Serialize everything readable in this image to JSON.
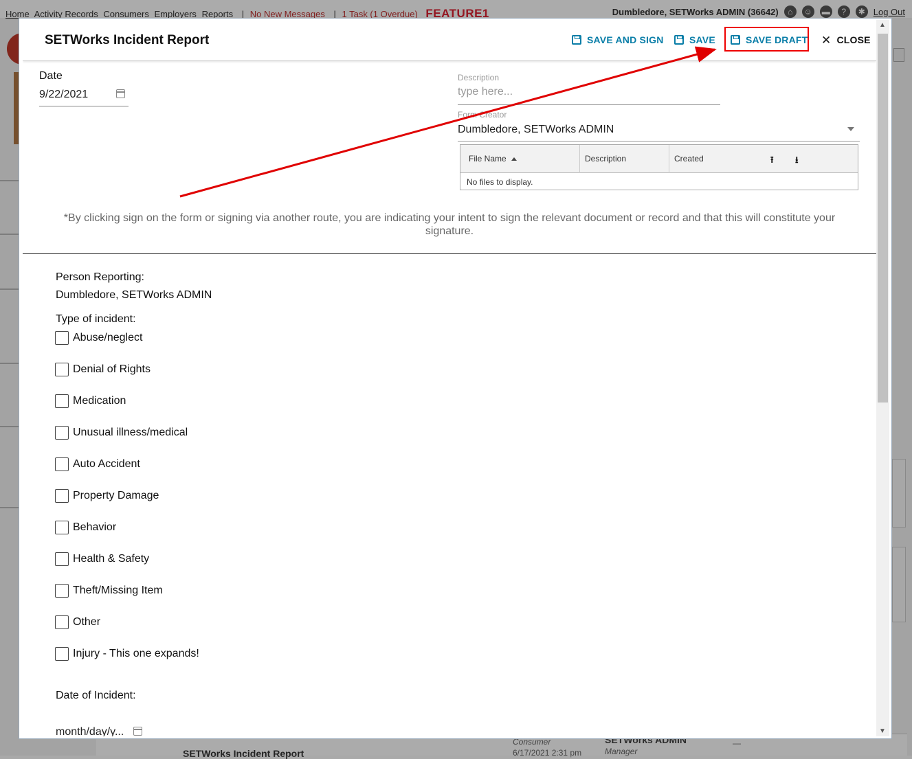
{
  "background": {
    "nav_links": [
      "Home",
      "Activity Records",
      "Consumers",
      "Employers",
      "Reports"
    ],
    "messages_link": "No New Messages",
    "tasks_link": "1 Task (1 Overdue)",
    "environment_label": "FEATURE1",
    "user_label": "Dumbledore, SETWorks ADMIN (36642)",
    "logout_label": "Log Out",
    "row_title": "SETWorks Incident Report",
    "row_consumer_label": "Consumer",
    "row_date": "6/17/2021 2:31 pm",
    "row_user": "SETWorks ADMIN",
    "row_role": "Manager",
    "row_dash": "—"
  },
  "modal": {
    "title": "SETWorks Incident Report",
    "actions": {
      "save_and_sign": "SAVE AND SIGN",
      "save": "SAVE",
      "save_draft": "SAVE DRAFT",
      "close": "CLOSE"
    },
    "date_label": "Date",
    "date_value": "9/22/2021",
    "description_label": "Description",
    "description_placeholder": "type here...",
    "form_creator_label": "Form Creator",
    "form_creator_value": "Dumbledore, SETWorks ADMIN",
    "files": {
      "columns": [
        "File Name",
        "Description",
        "Created"
      ],
      "empty_text": "No files to display."
    },
    "disclaimer": "*By clicking sign on the form or signing via another route, you are indicating your intent to sign the relevant document or record and that this will constitute your signature.",
    "person_reporting_label": "Person Reporting:",
    "person_reporting_value": "Dumbledore, SETWorks ADMIN",
    "incident_type_label": "Type of incident:",
    "incident_types": [
      "Abuse/neglect",
      "Denial of Rights",
      "Medication",
      "Unusual illness/medical",
      "Auto Accident",
      "Property Damage",
      "Behavior",
      "Health & Safety",
      "Theft/Missing Item",
      "Other",
      "Injury - This one expands!"
    ],
    "incident_date_label": "Date of Incident:",
    "incident_date_placeholder": "month/day/y..."
  },
  "colors": {
    "accent": "#0a7ea8",
    "annotation_red": "#e00000"
  },
  "icons": [
    "home-icon",
    "users-icon",
    "briefcase-icon",
    "help-icon",
    "gear-icon",
    "save-icon",
    "close-icon",
    "calendar-icon",
    "dropdown-icon",
    "sort-asc-icon",
    "upload-icon",
    "download-icon"
  ]
}
